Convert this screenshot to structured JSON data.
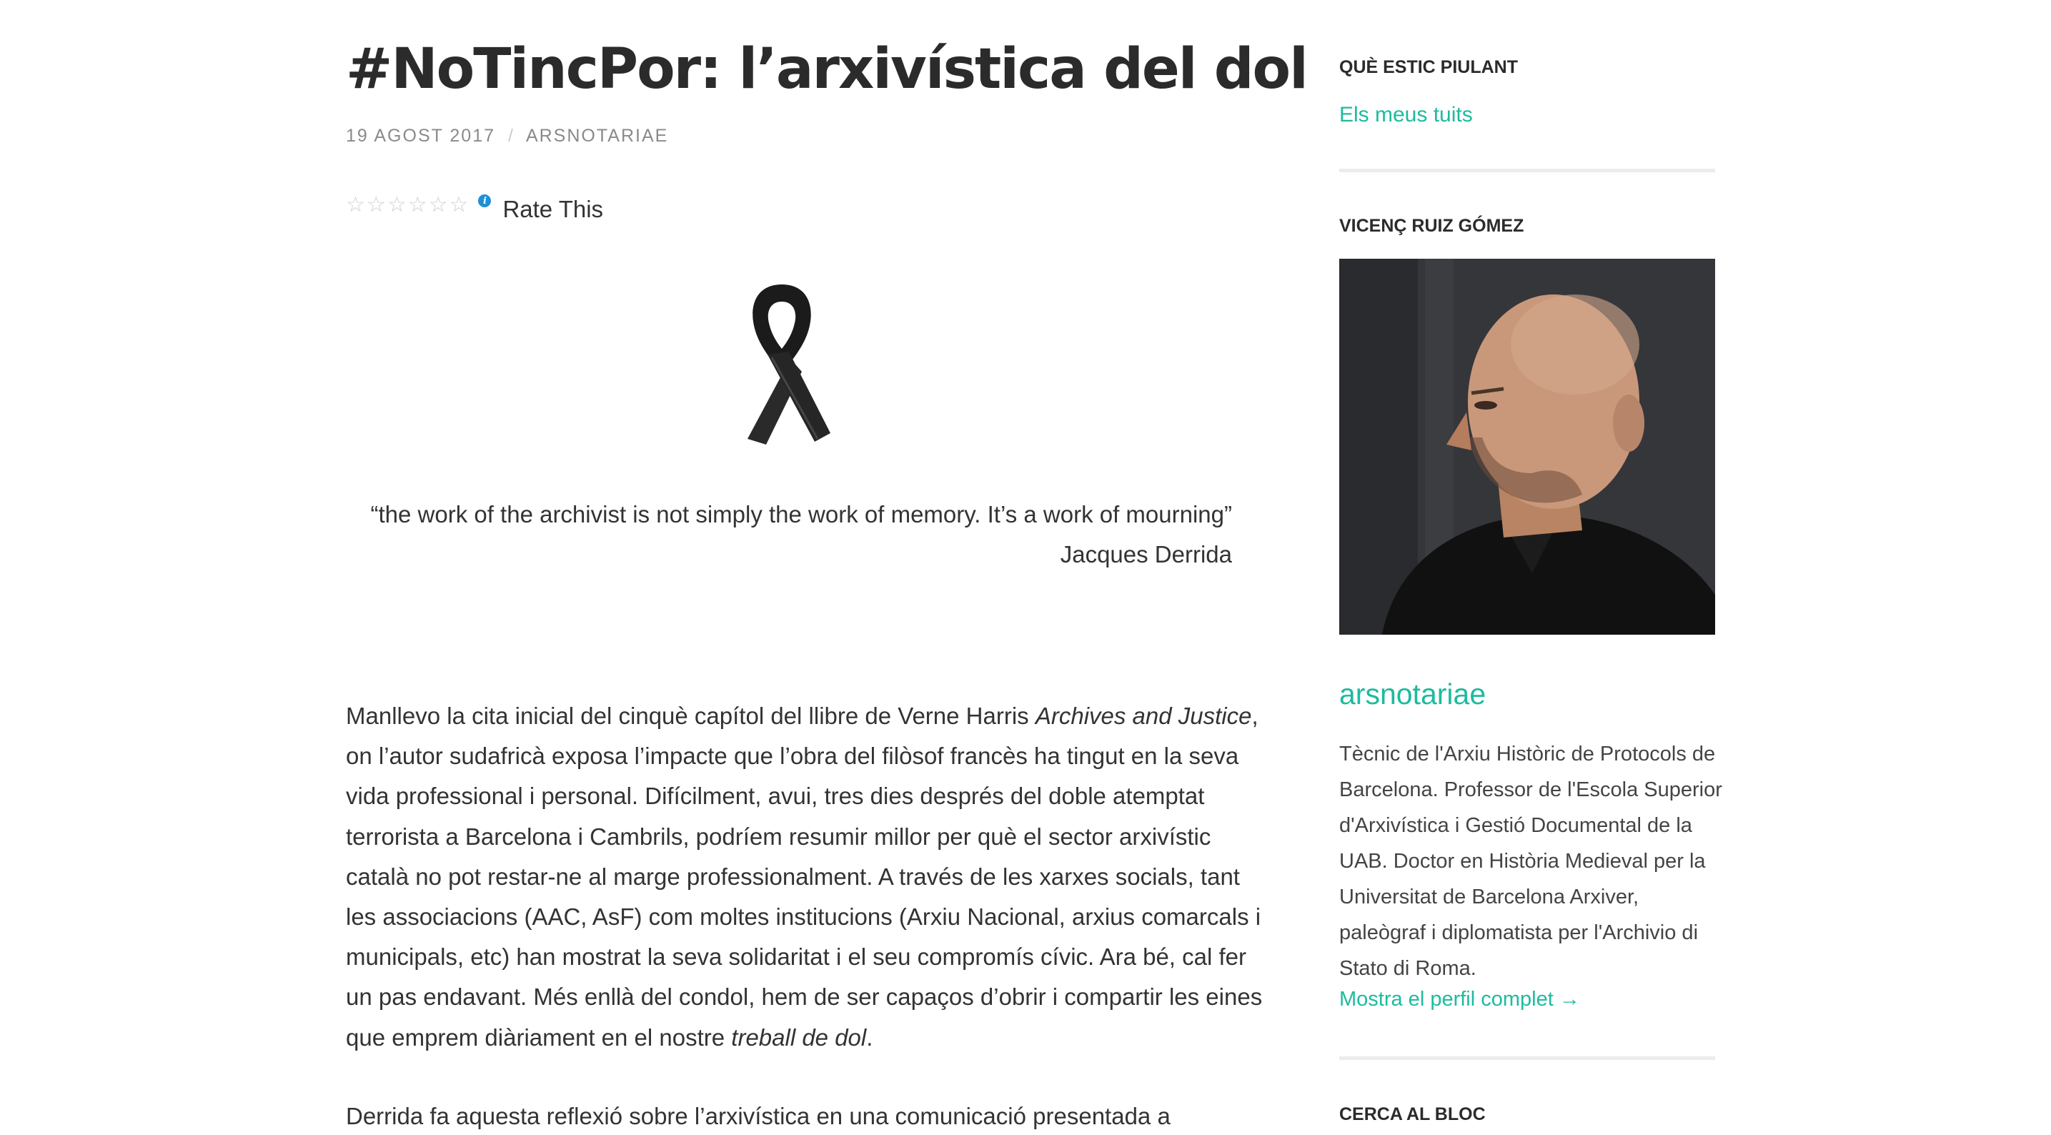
{
  "post": {
    "title": "#NoTincPor: l’arxivística del dol",
    "date": "19 AGOST 2017",
    "separator": "/",
    "author": "ARSNOTARIAE",
    "rating": {
      "stars": 0,
      "max_stars": 6,
      "info_icon": "i",
      "label": "Rate This"
    },
    "quote": {
      "text": "“the work of the archivist is not simply the work of memory. It’s a work of mourning”",
      "attribution": "Jacques Derrida"
    },
    "paragraph1": {
      "l1_pre": "Manllevo la cita inicial del cinquè capítol del llibre de Verne Harris ",
      "l1_em": "Archives and Justice",
      "l1_post": ",",
      "l2": "on l’autor sudafricà exposa l’impacte que l’obra del filòsof francès ha tingut en la seva",
      "l3": "vida professional i personal. Difícilment, avui, tres dies després del doble atemptat",
      "l4": "terrorista a Barcelona i Cambrils, podríem resumir millor per què el sector arxivístic",
      "l5": "català no pot restar-ne al marge professionalment. A través de les xarxes socials, tant",
      "l6": "les associacions (AAC, AsF) com moltes institucions (Arxiu Nacional, arxius comarcals i",
      "l7": "municipals, etc) han mostrat la seva solidaritat i el seu compromís cívic. Ara bé, cal fer",
      "l8": "un pas endavant. Més enllà del condol, hem de ser capaços d’obrir i compartir les eines",
      "l9_pre": "que emprem diàriament en el nostre ",
      "l9_em": "treball de dol",
      "l9_post": "."
    },
    "paragraph2": "Derrida fa aquesta reflexió sobre l’arxivística en una comunicació presentada a"
  },
  "sidebar": {
    "tweets": {
      "title": "QUÈ ESTIC PIULANT",
      "link": "Els meus tuits"
    },
    "profile": {
      "title": "VICENÇ RUIZ GÓMEZ",
      "name": "arsnotariae",
      "bio_lines": [
        "Tècnic de l'Arxiu Històric de Protocols de",
        "Barcelona. Professor de l'Escola Superior",
        "d'Arxivística i Gestió Documental de la",
        "UAB. Doctor en Història Medieval per la",
        "Universitat de Barcelona Arxiver,",
        "paleògraf i diplomatista per l'Archivio di",
        "Stato di Roma."
      ],
      "link": "Mostra el perfil complet →"
    },
    "search": {
      "title": "CERCA AL BLOC"
    }
  },
  "colors": {
    "accent": "#1dbb9e",
    "text": "#333333",
    "meta": "#8a8a8a",
    "divider": "#ececec"
  },
  "icons": [
    "star-icon",
    "info-icon",
    "black-ribbon-icon"
  ]
}
